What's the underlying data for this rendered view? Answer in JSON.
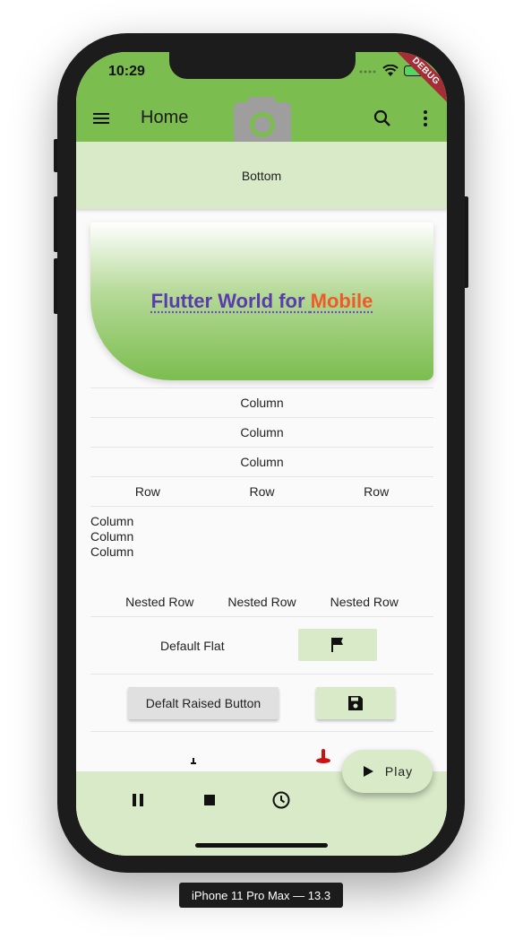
{
  "status_bar": {
    "time": "10:29",
    "debug_banner": "DEBUG"
  },
  "app_bar": {
    "title": "Home",
    "background_color": "#7cbd4f",
    "icons": [
      "menu-icon",
      "camera-icon",
      "search-icon",
      "more-vert-icon"
    ]
  },
  "bottom_strip": {
    "label": "Bottom",
    "background_color": "#d8eac7"
  },
  "card": {
    "title_part1": "Flutter World for ",
    "title_part2": "Mobile",
    "color_part1": "#5a3bb0",
    "color_part2": "#f05a2b"
  },
  "columns": [
    "Column",
    "Column",
    "Column"
  ],
  "row_items": [
    "Row",
    "Row",
    "Row"
  ],
  "left_columns": [
    "Column",
    "Column",
    "Column"
  ],
  "nested_rows": [
    "Nested Row",
    "Nested Row",
    "Nested Row"
  ],
  "buttons": {
    "flat_label": "Default Flat",
    "flag_icon": "flag-icon",
    "raised_label": "Defalt Raised Button",
    "save_icon": "save-icon"
  },
  "bottom_bar": {
    "icons": [
      "pause-icon",
      "stop-icon",
      "clock-icon"
    ]
  },
  "fab": {
    "label": "Play",
    "icon": "play-icon"
  },
  "device_label": "iPhone 11 Pro Max — 13.3"
}
